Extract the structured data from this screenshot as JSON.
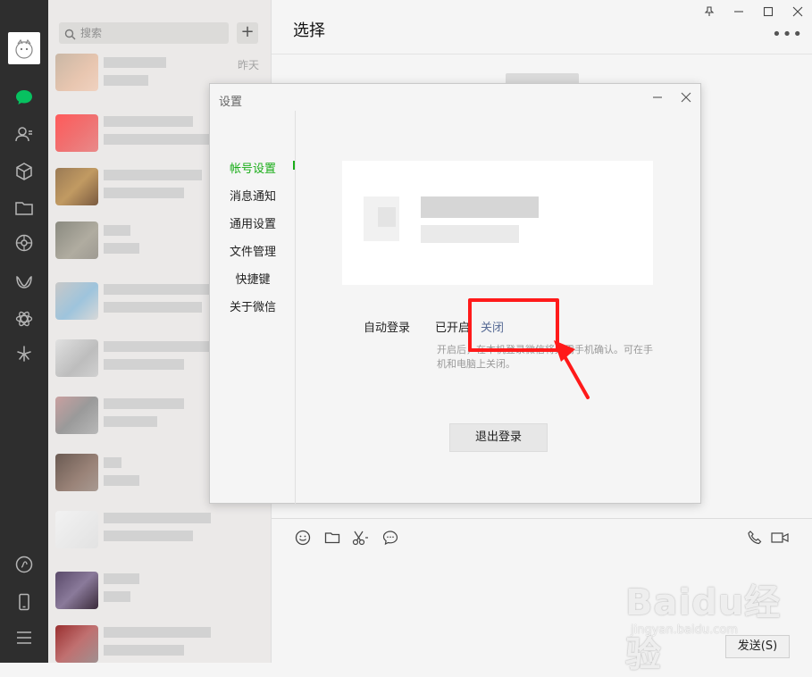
{
  "search": {
    "placeholder": "搜索"
  },
  "chat_list": {
    "first_time": "昨天"
  },
  "conversation": {
    "title": "选择",
    "send_label": "发送(S)"
  },
  "dialog": {
    "title": "设置",
    "nav": [
      "帐号设置",
      "消息通知",
      "通用设置",
      "文件管理",
      "快捷键",
      "关于微信"
    ],
    "active_index": 0,
    "autologin_label": "自动登录",
    "autologin_state": "已开启",
    "autologin_close": "关闭",
    "autologin_hint": "开启后，在本机登录微信将无需手机确认。可在手机和电脑上关闭。",
    "logout_label": "退出登录"
  },
  "watermark": {
    "text": "Baidu经验",
    "url": "jingyan.baidu.com"
  },
  "colors": {
    "accent": "#1aad19",
    "link": "#576b95",
    "highlight": "#ff1a1a",
    "rail": "#2e2e2e"
  }
}
